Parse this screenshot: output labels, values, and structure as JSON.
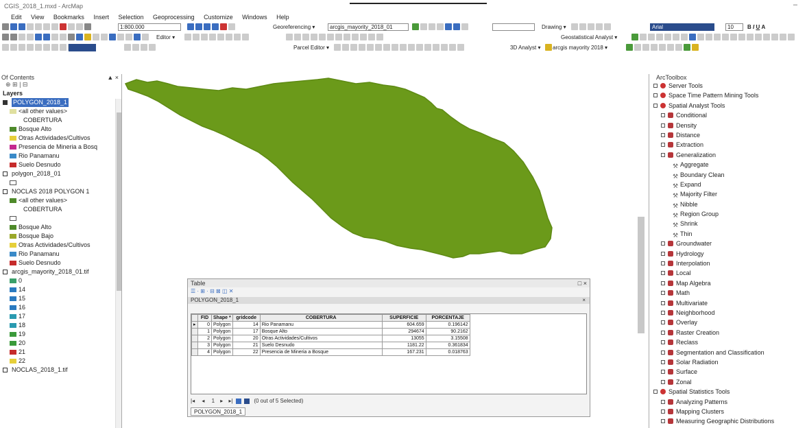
{
  "window": {
    "title": "CGIS_2018_1.mxd - ArcMap",
    "minimize": "–"
  },
  "menu": [
    "Edit",
    "View",
    "Bookmarks",
    "Insert",
    "Selection",
    "Geoprocessing",
    "Customize",
    "Windows",
    "Help"
  ],
  "toolbar": {
    "scale": "1:800.000",
    "georef_label": "Georeferencing ▾",
    "georef_layer": "arcgis_mayority_2018_01",
    "drawing_label": "Drawing ▾",
    "font_name": "Arial",
    "font_size": "10",
    "editor_label": "Editor ▾",
    "geostat_label": "Geostatistical Analyst ▾",
    "parcel_label": "Parcel Editor ▾",
    "analyst3d_label": "3D Analyst ▾",
    "analyst3d_layer": "arcgis mayority 2018 ▾"
  },
  "toc": {
    "title": "Of Contents",
    "close": "▲ ×",
    "tabs": "⊕ ⊞ | ⊟",
    "items": [
      {
        "text": "Layers",
        "indent": 0,
        "kind": "header"
      },
      {
        "text": "POLYGON_2018_1",
        "indent": 0,
        "kind": "layer-selected"
      },
      {
        "text": "<all other values>",
        "indent": 1,
        "kind": "legend",
        "color": "#e0e0a0"
      },
      {
        "text": "COBERTURA",
        "indent": 2,
        "kind": "text"
      },
      {
        "text": "Bosque Alto",
        "indent": 1,
        "kind": "legend",
        "color": "#4e8a2a"
      },
      {
        "text": "Otras Actividades/Cultivos",
        "indent": 1,
        "kind": "legend",
        "color": "#e6cf3a"
      },
      {
        "text": "Presencia de Mineria a Bosq",
        "indent": 1,
        "kind": "legend",
        "color": "#c4298f"
      },
      {
        "text": "Rio Panamanu",
        "indent": 1,
        "kind": "legend",
        "color": "#3a8ac8"
      },
      {
        "text": "Suelo Desnudo",
        "indent": 1,
        "kind": "legend",
        "color": "#c62b2b"
      },
      {
        "text": "polygon_2018_01",
        "indent": 0,
        "kind": "layer"
      },
      {
        "text": "",
        "indent": 1,
        "kind": "legend-empty"
      },
      {
        "text": "NOCLAS 2018 POLYGON 1",
        "indent": 0,
        "kind": "layer-open"
      },
      {
        "text": "<all other values>",
        "indent": 1,
        "kind": "legend",
        "color": "#4e8a2a"
      },
      {
        "text": "COBERTURA",
        "indent": 2,
        "kind": "text"
      },
      {
        "text": "",
        "indent": 1,
        "kind": "legend-empty"
      },
      {
        "text": "Bosque Alto",
        "indent": 1,
        "kind": "legend",
        "color": "#4e8a2a"
      },
      {
        "text": "Bosque Bajo",
        "indent": 1,
        "kind": "legend",
        "color": "#9aa82a"
      },
      {
        "text": "Otras Actividades/Cultivos",
        "indent": 1,
        "kind": "legend",
        "color": "#e6cf3a"
      },
      {
        "text": "Rio Panamanu",
        "indent": 1,
        "kind": "legend",
        "color": "#3a8ac8"
      },
      {
        "text": "Suelo Desnudo",
        "indent": 1,
        "kind": "legend",
        "color": "#c62b2b"
      },
      {
        "text": "arcgis_mayority_2018_01.tif",
        "indent": 0,
        "kind": "layer"
      },
      {
        "text": "0",
        "indent": 1,
        "kind": "legend",
        "color": "#3aa06a"
      },
      {
        "text": "14",
        "indent": 1,
        "kind": "legend",
        "color": "#2a7ac0"
      },
      {
        "text": "15",
        "indent": 1,
        "kind": "legend",
        "color": "#2a7ac0"
      },
      {
        "text": "16",
        "indent": 1,
        "kind": "legend",
        "color": "#2a7ac0"
      },
      {
        "text": "17",
        "indent": 1,
        "kind": "legend",
        "color": "#2a9ab0"
      },
      {
        "text": "18",
        "indent": 1,
        "kind": "legend",
        "color": "#2a9ab0"
      },
      {
        "text": "19",
        "indent": 1,
        "kind": "legend",
        "color": "#3a9a3a"
      },
      {
        "text": "20",
        "indent": 1,
        "kind": "legend",
        "color": "#3a9a3a"
      },
      {
        "text": "21",
        "indent": 1,
        "kind": "legend",
        "color": "#c62b2b"
      },
      {
        "text": "22",
        "indent": 1,
        "kind": "legend",
        "color": "#e6cf3a"
      },
      {
        "text": "NOCLAS_2018_1.tif",
        "indent": 0,
        "kind": "layer"
      }
    ]
  },
  "map": {
    "polygon_color": "#6b9a1a"
  },
  "table": {
    "title": "Table",
    "close": "□ ×",
    "tools": "☰ · ⊞ · ⊟ ⊠ ◫ ✕",
    "layer_tab": "POLYGON_2018_1",
    "columns": [
      "FID",
      "Shape *",
      "gridcode",
      "COBERTURA",
      "SUPERFICIE",
      "PORCENTAJE"
    ],
    "rows": [
      [
        "0",
        "Polygon",
        "14",
        "Rio Panamanu",
        "604.659",
        "0.196142"
      ],
      [
        "1",
        "Polygon",
        "17",
        "Bosque Alto",
        "294674",
        "90.2162"
      ],
      [
        "2",
        "Polygon",
        "20",
        "Otras Actividades/Cultivos",
        "13055",
        "3.15508"
      ],
      [
        "3",
        "Polygon",
        "21",
        "Suelo Desnudo",
        "1181.22",
        "0.361834"
      ],
      [
        "4",
        "Polygon",
        "22",
        "Presencia de Mineria a Bosque",
        "167.231",
        "0.018763"
      ]
    ],
    "footer": "(0 out of 5 Selected)",
    "bottom_tab": "POLYGON_2018_1"
  },
  "toolbox": {
    "title": "ArcToolbox",
    "items": [
      {
        "text": "Server Tools",
        "indent": 0,
        "kind": "box"
      },
      {
        "text": "Space Time Pattern Mining Tools",
        "indent": 0,
        "kind": "box"
      },
      {
        "text": "Spatial Analyst Tools",
        "indent": 0,
        "kind": "box"
      },
      {
        "text": "Conditional",
        "indent": 1,
        "kind": "sub"
      },
      {
        "text": "Density",
        "indent": 1,
        "kind": "sub"
      },
      {
        "text": "Distance",
        "indent": 1,
        "kind": "sub"
      },
      {
        "text": "Extraction",
        "indent": 1,
        "kind": "sub"
      },
      {
        "text": "Generalization",
        "indent": 1,
        "kind": "sub"
      },
      {
        "text": "Aggregate",
        "indent": 2,
        "kind": "tool"
      },
      {
        "text": "Boundary Clean",
        "indent": 2,
        "kind": "tool"
      },
      {
        "text": "Expand",
        "indent": 2,
        "kind": "tool"
      },
      {
        "text": "Majority Filter",
        "indent": 2,
        "kind": "tool"
      },
      {
        "text": "Nibble",
        "indent": 2,
        "kind": "tool"
      },
      {
        "text": "Region Group",
        "indent": 2,
        "kind": "tool"
      },
      {
        "text": "Shrink",
        "indent": 2,
        "kind": "tool"
      },
      {
        "text": "Thin",
        "indent": 2,
        "kind": "tool"
      },
      {
        "text": "Groundwater",
        "indent": 1,
        "kind": "sub"
      },
      {
        "text": "Hydrology",
        "indent": 1,
        "kind": "sub"
      },
      {
        "text": "Interpolation",
        "indent": 1,
        "kind": "sub"
      },
      {
        "text": "Local",
        "indent": 1,
        "kind": "sub"
      },
      {
        "text": "Map Algebra",
        "indent": 1,
        "kind": "sub"
      },
      {
        "text": "Math",
        "indent": 1,
        "kind": "sub"
      },
      {
        "text": "Multivariate",
        "indent": 1,
        "kind": "sub"
      },
      {
        "text": "Neighborhood",
        "indent": 1,
        "kind": "sub"
      },
      {
        "text": "Overlay",
        "indent": 1,
        "kind": "sub"
      },
      {
        "text": "Raster Creation",
        "indent": 1,
        "kind": "sub"
      },
      {
        "text": "Reclass",
        "indent": 1,
        "kind": "sub"
      },
      {
        "text": "Segmentation and Classification",
        "indent": 1,
        "kind": "sub"
      },
      {
        "text": "Solar Radiation",
        "indent": 1,
        "kind": "sub"
      },
      {
        "text": "Surface",
        "indent": 1,
        "kind": "sub"
      },
      {
        "text": "Zonal",
        "indent": 1,
        "kind": "sub"
      },
      {
        "text": "Spatial Statistics Tools",
        "indent": 0,
        "kind": "box"
      },
      {
        "text": "Analyzing Patterns",
        "indent": 1,
        "kind": "sub"
      },
      {
        "text": "Mapping Clusters",
        "indent": 1,
        "kind": "sub"
      },
      {
        "text": "Measuring Geographic Distributions",
        "indent": 1,
        "kind": "sub"
      }
    ]
  }
}
